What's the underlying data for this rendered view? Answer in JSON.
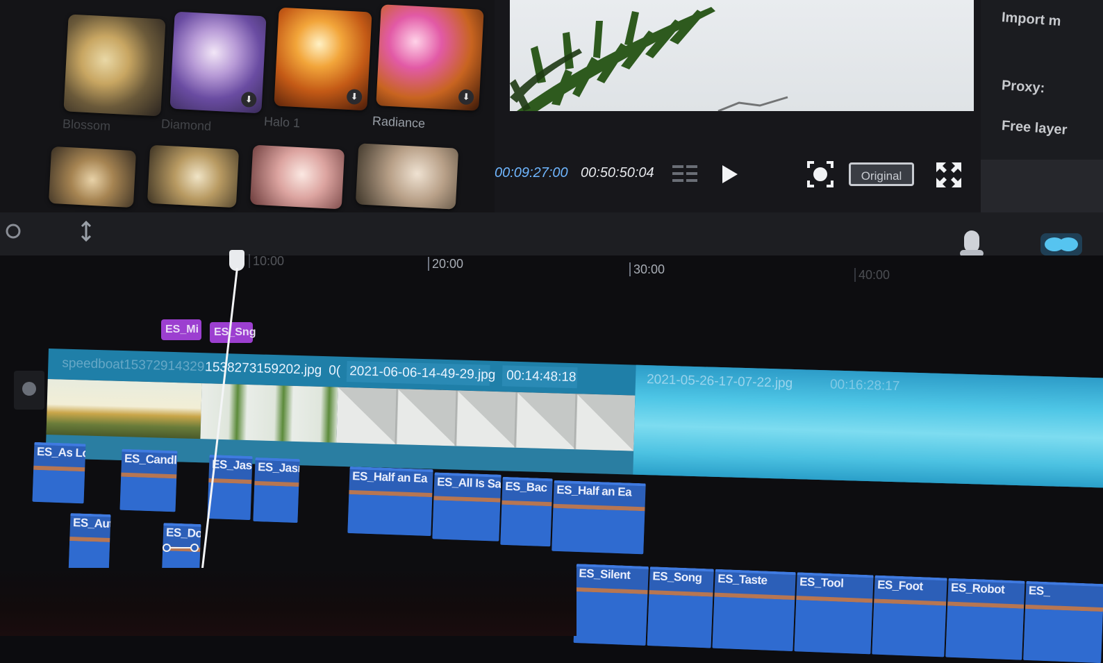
{
  "effects": {
    "items": [
      {
        "label": "Blossom",
        "download": false
      },
      {
        "label": "Diamond",
        "download": false
      },
      {
        "label": "Halo 1",
        "download": true
      },
      {
        "label": "Radiance",
        "download": true
      },
      {
        "label": "",
        "download": false
      },
      {
        "label": "",
        "download": false
      },
      {
        "label": "",
        "download": false
      },
      {
        "label": "",
        "download": false
      }
    ],
    "download_icon": "download-icon"
  },
  "preview": {
    "current_time": "00:09:27:00",
    "total_time": "00:50:50:04",
    "aspect_label": "Original"
  },
  "settings": {
    "items": [
      "Import m",
      "Proxy:",
      "Free layer"
    ]
  },
  "timeline": {
    "ruler": [
      "10:00",
      "20:00",
      "30:00",
      "40:00"
    ],
    "text_clips": [
      "ES_Mi",
      "ES_Sng"
    ],
    "video_clips": [
      {
        "name": "speedboat15372914329...",
        "time": ""
      },
      {
        "name": "1538273159202.jpg",
        "time": "0("
      },
      {
        "name": "2021-06-06-14-49-29.jpg",
        "time": "00:14:48:18"
      },
      {
        "name": "2021-05-26-17-07-22.jpg",
        "time": "00:16:28:17"
      }
    ],
    "audio_row1": [
      "ES_As Lo",
      "ES_Candl",
      "ES_Jasn",
      "ES_Jasn",
      "ES_Half an Ea",
      "ES_All Is Sa",
      "ES_Bac",
      "ES_Half an Ea"
    ],
    "audio_row2": [
      "ES_Aut",
      "ES_Do"
    ],
    "audio_row3": [
      "ES_Silent",
      "ES_Song",
      "ES_Taste",
      "ES_Tool",
      "ES_Foot",
      "ES_Robot",
      "ES_"
    ]
  },
  "colors": {
    "accent_cyan": "#3fb6d9",
    "text_clip": "#9c3fd0",
    "audio_clip": "#2f6bd0",
    "timecode_blue": "#6fb6ff"
  }
}
